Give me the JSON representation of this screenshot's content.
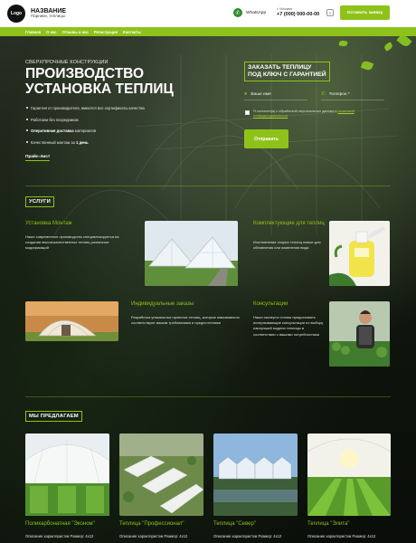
{
  "header": {
    "logo": "Logo",
    "name": "НАЗВАНИЕ",
    "subtitle": "Парники, теплицы",
    "whatsapp_icon": "whatsapp-icon",
    "whatsapp": "WhatsApp",
    "city": "г. Москва",
    "phone": "+7 (000) 000-00-00",
    "cta": "Оставить заявку"
  },
  "nav": [
    "Главная",
    "О нас",
    "Отзывы о нас",
    "Регистрация",
    "Контакты"
  ],
  "hero": {
    "eyebrow": "СВЕРХПРОЧНЫЕ КОНСТРУКЦИИ",
    "title_line1": "ПРОИЗВОДСТВО",
    "title_line2": "УСТАНОВКА ТЕПЛИЦ",
    "bullets": [
      {
        "strong": "",
        "text": "Гарантия от производителя, имеются все сертификаты качества"
      },
      {
        "strong": "",
        "text": "Работаем без посредников"
      },
      {
        "strong": "Оперативная доставка",
        "text": " материалов"
      },
      {
        "strong": "",
        "text": "Качественный монтаж за ",
        "tail": "1 день"
      }
    ],
    "price_link": "Прайс-лист"
  },
  "form": {
    "title_line1": "ЗАКАЗАТЬ ТЕПЛИЦУ",
    "title_line2": "ПОД КЛЮЧ С ГАРАНТИЕЙ",
    "name_placeholder": "Ваше имя",
    "phone_placeholder": "Телефон *",
    "consent_text": "Я согласен(а) с обработкой персональных данных и ",
    "consent_link": "политикой конфиденциальности",
    "submit": "Отправить"
  },
  "services": {
    "heading": "УСЛУГИ",
    "items": [
      {
        "title": "Установка Монтаж",
        "text": "Наше современное производство специализируется на создании высококачественных теплиц различных модификаций"
      },
      {
        "title": "Комплектующие для теплиц",
        "text": "Изготовление старых теплиц новые для обновления или изменения вида"
      },
      {
        "title": "Индивидуальные заказы",
        "text": "Разработка уникальных проектов теплиц, которые максимально соответствуют вашим требованиям и предпочтениям"
      },
      {
        "title": "Консультации",
        "text": "Наши эксперты готовы предоставить исчерпывающие консультации по выбору наилучшей модели теплицы в соответствии с вашими потребностями"
      }
    ]
  },
  "products": {
    "heading": "МЫ ПРЕДЛАГАЕМ",
    "items": [
      {
        "name": "Поликарбонатная \"Эконом\"",
        "desc": "Описание характеристик Размер: 4х12"
      },
      {
        "name": "Теплица \"Профессионал\"",
        "desc": "Описание характеристик Размер: 4х12"
      },
      {
        "name": "Теплица \"Север\"",
        "desc": "Описание характеристик Размер: 4х12"
      },
      {
        "name": "Теплица \"Элита\"",
        "desc": "Описание характеристик Размер: 4х12"
      }
    ]
  },
  "colors": {
    "accent": "#8ec21a",
    "header_bg": "#ffffff",
    "page_bg": "#0d120b"
  }
}
